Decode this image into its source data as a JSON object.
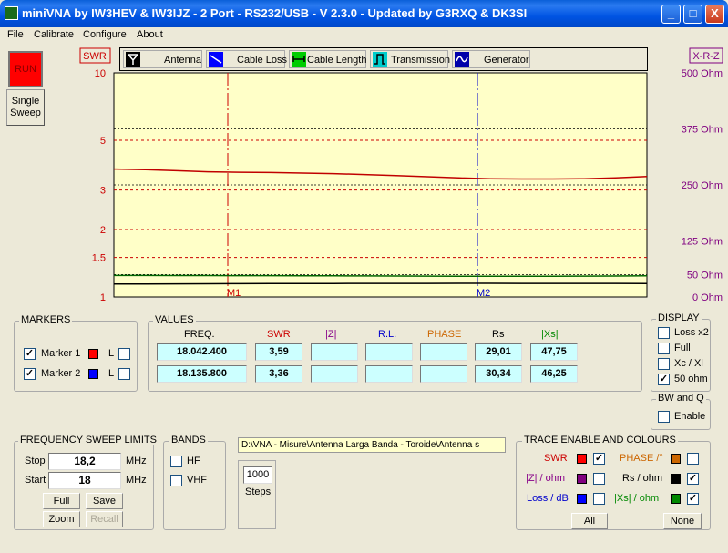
{
  "window": {
    "title": "miniVNA by IW3HEV & IW3IJZ - 2 Port - RS232/USB - V 2.3.0 - Updated by G3RXQ & DK3SI",
    "min": "_",
    "max": "□",
    "close": "X"
  },
  "menu": [
    "File",
    "Calibrate",
    "Configure",
    "About"
  ],
  "run_label": "RUN",
  "single_sweep": [
    "Single",
    "Sweep"
  ],
  "toolbar": [
    "Antenna",
    "Cable Loss",
    "Cable Length",
    "Transmission",
    "Generator"
  ],
  "chart_data": {
    "type": "line",
    "left_axis": {
      "label": "SWR",
      "ticks": [
        "10",
        "5",
        "3",
        "2",
        "1.5",
        "1"
      ]
    },
    "right_axis": {
      "label": "X-R-Z",
      "ticks": [
        "500 Ohm",
        "375 Ohm",
        "250 Ohm",
        "125 Ohm",
        "50 Ohm",
        "0 Ohm"
      ]
    },
    "markers": [
      "M1",
      "M2"
    ],
    "series": [
      {
        "name": "SWR",
        "color": "#c00000",
        "values": [
          3.72,
          3.7,
          3.66,
          3.62,
          3.6,
          3.59,
          3.57,
          3.55,
          3.52,
          3.48,
          3.44,
          3.4,
          3.37,
          3.36,
          3.36,
          3.37,
          3.4,
          3.45
        ]
      },
      {
        "name": "Rs / ohm",
        "color": "#000000",
        "values": [
          29,
          29.1,
          29.3,
          29.5,
          29.6,
          29.8,
          30,
          30.1,
          30.2,
          30.3,
          30.3,
          30.4,
          30.4,
          30.3,
          30.3,
          30.2,
          30.2,
          30.1
        ]
      },
      {
        "name": "|Xs| / ohm",
        "color": "#006600",
        "values": [
          48,
          47.9,
          47.8,
          47.7,
          47.6,
          47.5,
          47.3,
          47.1,
          46.9,
          46.7,
          46.5,
          46.3,
          46.2,
          46.2,
          46.3,
          46.5,
          46.8,
          47.2
        ]
      }
    ]
  },
  "markers": {
    "title": "MARKERS",
    "m1": "Marker 1",
    "m2": "Marker 2",
    "l": "L",
    "m1_checked": "✓",
    "m2_checked": "✓",
    "m1_color": "#ff0000",
    "m2_color": "#0000ff"
  },
  "values": {
    "title": "VALUES",
    "headers": [
      "FREQ.",
      "SWR",
      "|Z|",
      "R.L.",
      "PHASE",
      "Rs",
      "|Xs|"
    ],
    "row1": [
      "18.042.400",
      "3,59",
      "",
      "",
      "",
      "29,01",
      "47,75"
    ],
    "row2": [
      "18.135.800",
      "3,36",
      "",
      "",
      "",
      "30,34",
      "46,25"
    ]
  },
  "display": {
    "title": "DISPLAY",
    "items": [
      "Loss x2",
      "Full",
      "Xc / Xl",
      "50 ohm"
    ],
    "checked": [
      "",
      "",
      "",
      "✓"
    ]
  },
  "bwq": {
    "title": "BW and Q",
    "enable": "Enable"
  },
  "sweep": {
    "title": "FREQUENCY SWEEP LIMITS",
    "stop_label": "Stop",
    "stop": "18,2",
    "start_label": "Start",
    "start": "18",
    "unit": "MHz",
    "full": "Full",
    "save": "Save",
    "zoom": "Zoom",
    "recall": "Recall"
  },
  "bands": {
    "title": "BANDS",
    "hf": "HF",
    "vhf": "VHF"
  },
  "file_path": "D:\\VNA - Misure\\Antenna Larga Banda - Toroide\\Antenna s",
  "steps": {
    "value": "1000",
    "label": "Steps"
  },
  "trace": {
    "title": "TRACE ENABLE AND COLOURS",
    "swr": "SWR",
    "phase": "PHASE /°",
    "z": "|Z| / ohm",
    "rs": "Rs / ohm",
    "loss": "Loss / dB",
    "xs": "|Xs| / ohm",
    "check": "✓",
    "all": "All",
    "none": "None"
  }
}
